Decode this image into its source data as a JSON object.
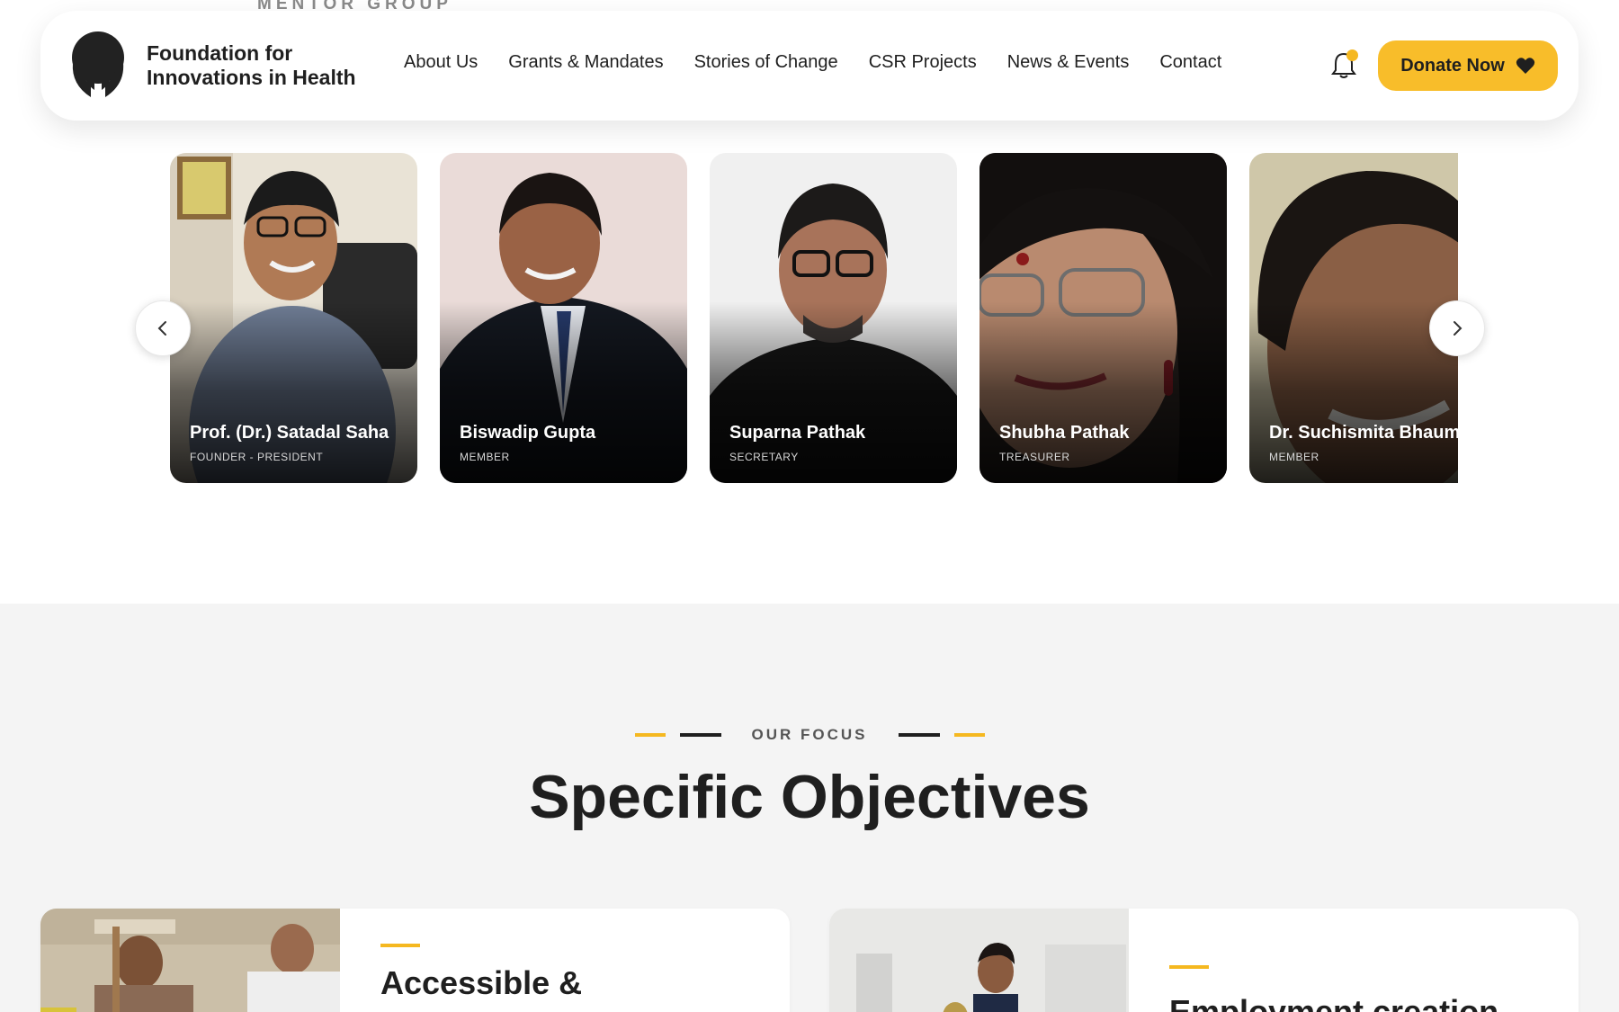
{
  "header": {
    "section_peek": "MENTOR GROUP",
    "brand_line1": "Foundation for",
    "brand_line2": "Innovations in Health",
    "nav": [
      "About Us",
      "Grants & Mandates",
      "Stories of Change",
      "CSR Projects",
      "News & Events",
      "Contact"
    ],
    "donate_label": "Donate Now"
  },
  "members": [
    {
      "name": "Prof. (Dr.) Satadal Saha",
      "role": "FOUNDER - PRESIDENT"
    },
    {
      "name": "Biswadip Gupta",
      "role": "MEMBER"
    },
    {
      "name": "Suparna Pathak",
      "role": "SECRETARY"
    },
    {
      "name": "Shubha Pathak",
      "role": "TREASURER"
    },
    {
      "name": "Dr. Suchismita Bhaumik",
      "role": "MEMBER"
    }
  ],
  "focus": {
    "eyebrow": "OUR FOCUS",
    "title": "Specific Objectives",
    "cards": [
      {
        "title": "Accessible &"
      },
      {
        "title": "Employment creation"
      }
    ]
  },
  "colors": {
    "accent": "#f8bd2a",
    "dark": "#1f1f1f",
    "section_bg": "#f4f4f4"
  }
}
